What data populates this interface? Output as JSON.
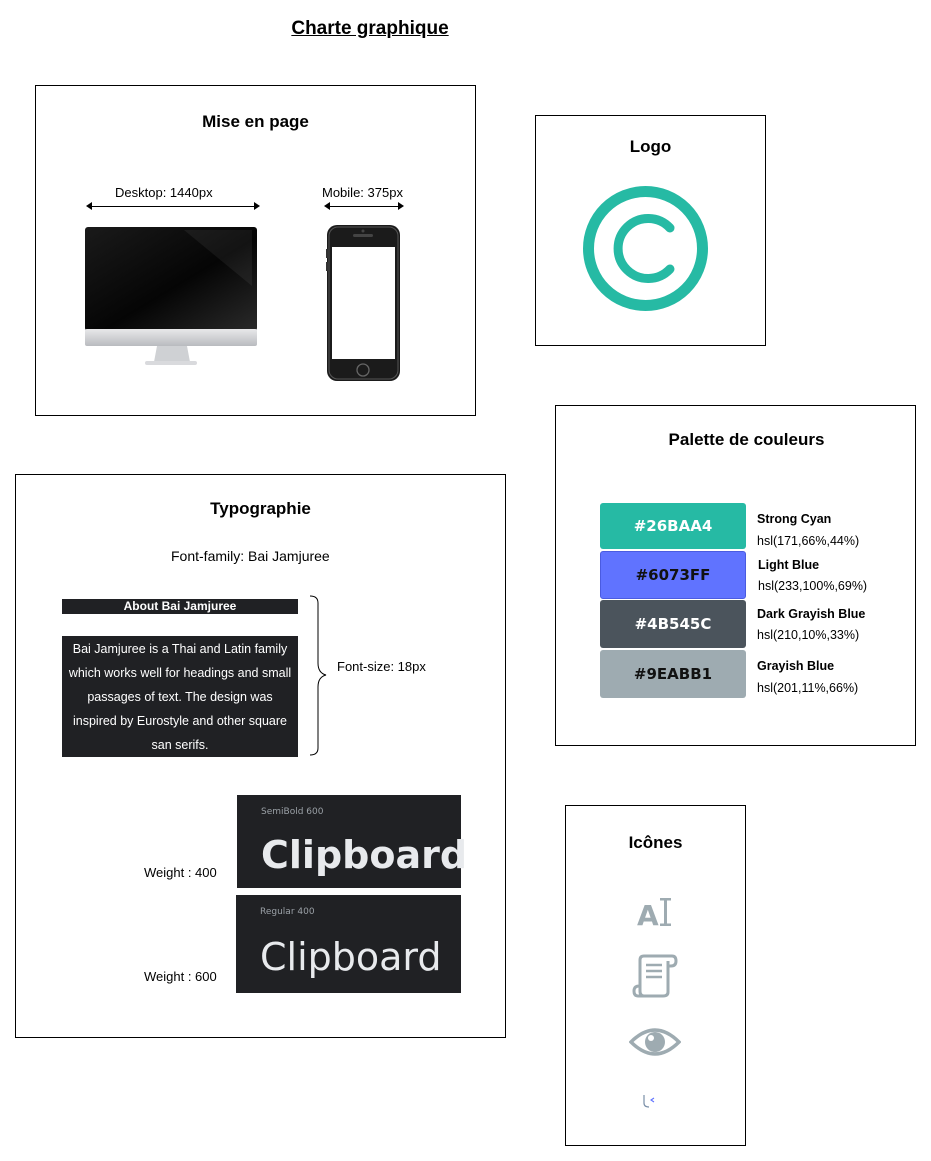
{
  "page_title": "Charte graphique",
  "layout_section": {
    "title": "Mise en page",
    "desktop_label": "Desktop: 1440px",
    "mobile_label": "Mobile: 375px"
  },
  "logo_section": {
    "title": "Logo",
    "logo_color": "#26BAA4"
  },
  "palette_section": {
    "title": "Palette de couleurs",
    "colors": [
      {
        "hex": "#26BAA4",
        "name": "Strong Cyan",
        "hsl": "hsl(171,66%,44%)"
      },
      {
        "hex": "#6073FF",
        "name": "Light Blue",
        "hsl": "hsl(233,100%,69%)"
      },
      {
        "hex": "#4B545C",
        "name": "Dark Grayish Blue",
        "hsl": "hsl(210,10%,33%)"
      },
      {
        "hex": "#9EABB1",
        "name": "Grayish Blue",
        "hsl": "hsl(201,11%,66%)"
      }
    ]
  },
  "typography_section": {
    "title": "Typographie",
    "font_family": "Font-family: Bai Jamjuree",
    "sample_heading": "About Bai Jamjuree",
    "sample_lines": [
      "Bai Jamjuree is a Thai and Latin family",
      "which works well for headings and small",
      "passages of text. The design was",
      "inspired by Eurostyle and other square",
      "san serifs."
    ],
    "font_size": "Font-size: 18px",
    "weight_400": "Weight : 400",
    "weight_600": "Weight : 600",
    "semibold_caption": "SemiBold 600",
    "regular_caption": "Regular 400",
    "sample_word": "Clipboard"
  },
  "icons_section": {
    "title": "Icônes",
    "icon_color": "#9EABB1",
    "icons": [
      "text-icon",
      "document-scroll-icon",
      "eye-icon",
      "cursor-icon"
    ]
  }
}
